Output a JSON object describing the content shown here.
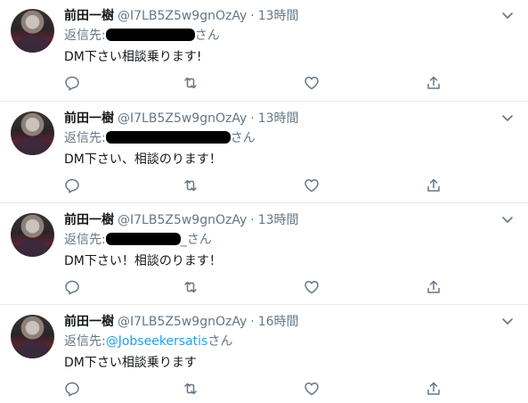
{
  "tweets": [
    {
      "name": "前田一樹",
      "handle": "@I7LB5Z5w9gnOzAy",
      "time": "13時間",
      "reply_prefix": "返信先:",
      "reply_suffix": "さん",
      "reply_mention": "",
      "text": "DM下さい相談乗ります!"
    },
    {
      "name": "前田一樹",
      "handle": "@I7LB5Z5w9gnOzAy",
      "time": "13時間",
      "reply_prefix": "返信先:",
      "reply_suffix": "さん",
      "reply_mention": "",
      "text": "DM下さい、相談のります！"
    },
    {
      "name": "前田一樹",
      "handle": "@I7LB5Z5w9gnOzAy",
      "time": "13時間",
      "reply_prefix": "返信先:",
      "reply_suffix": "_さん",
      "reply_mention": "",
      "text": "DM下さい！相談のります！"
    },
    {
      "name": "前田一樹",
      "handle": "@I7LB5Z5w9gnOzAy",
      "time": "16時間",
      "reply_prefix": "返信先:",
      "reply_suffix": "さん",
      "reply_mention": "@Jobseekersatis",
      "text": "DM下さい相談乗ります"
    }
  ],
  "separator": "·",
  "icons": {
    "reply": "reply-icon",
    "retweet": "retweet-icon",
    "like": "heart-icon",
    "share": "share-icon",
    "menu": "chevron-down-icon"
  },
  "colors": {
    "mention": "#1da1f2",
    "secondary_text": "#657786",
    "divider": "#e6ecf0",
    "redaction": "#000000"
  }
}
